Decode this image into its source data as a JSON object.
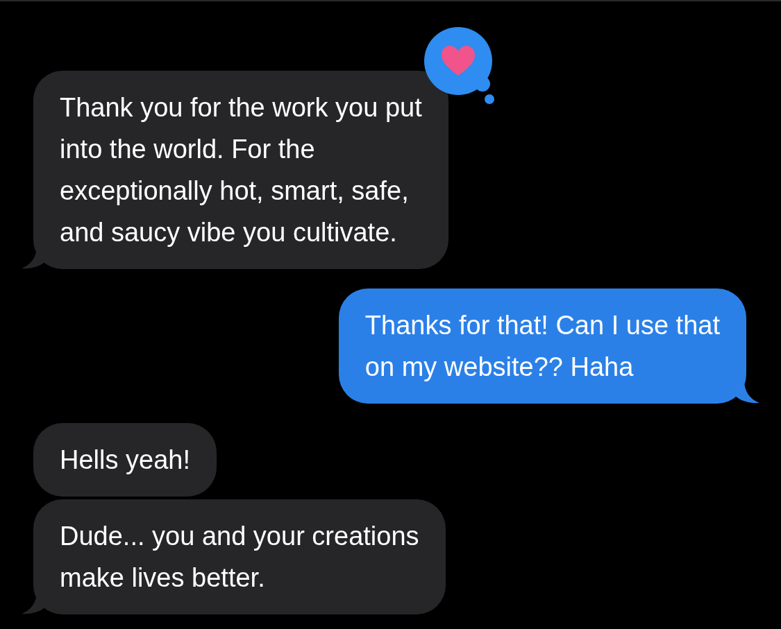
{
  "messages": [
    {
      "kind": "received",
      "lines": [
        "Thank you for the work you put",
        "into the world. For the",
        "exceptionally hot, smart, safe,",
        "and saucy vibe you cultivate."
      ],
      "tail": true,
      "hearted": true
    },
    {
      "kind": "sent",
      "lines": [
        "Thanks for that! Can I use that",
        "on my website?? Haha"
      ],
      "tail": true,
      "hearted": false
    },
    {
      "kind": "received",
      "lines": [
        "Hells yeah!"
      ],
      "tail": false,
      "hearted": false
    },
    {
      "kind": "received",
      "lines": [
        "Dude... you and your creations",
        "make lives better."
      ],
      "tail": true,
      "hearted": false
    }
  ]
}
